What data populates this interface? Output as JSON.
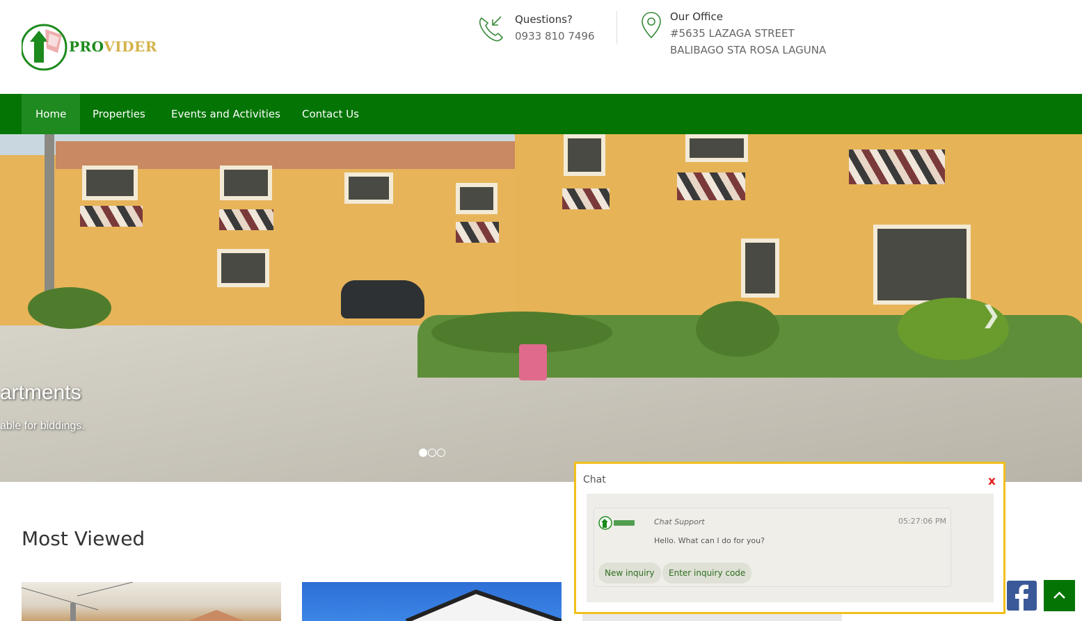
{
  "brand": {
    "logo_text_a": "PRO",
    "logo_text_b": "VIDER"
  },
  "contact": {
    "phone_label": "Questions?",
    "phone_value": "0933 810 7496",
    "office_label": "Our Office",
    "office_line1": "#5635 LAZAGA STREET",
    "office_line2": "BALIBAGO STA ROSA LAGUNA"
  },
  "nav": {
    "items": [
      "Home",
      "Properties",
      "Events and Activities",
      "Contact Us"
    ],
    "active": "Home"
  },
  "hero": {
    "caption_title": "artments",
    "caption_sub": "able for biddings.",
    "slide_count": 3,
    "active_slide": 1
  },
  "most_viewed": {
    "title": "Most Viewed"
  },
  "chat": {
    "title": "Chat",
    "close_label": "x",
    "sender": "Chat Support",
    "time": "05:27:06 PM",
    "message": "Hello. What can I do for you?",
    "buttons": [
      "New inquiry",
      "Enter inquiry code"
    ]
  },
  "colors": {
    "nav_green": "#047505",
    "chat_border": "#f2bf1b",
    "close_red": "#e51b1b",
    "facebook": "#3b5998"
  }
}
